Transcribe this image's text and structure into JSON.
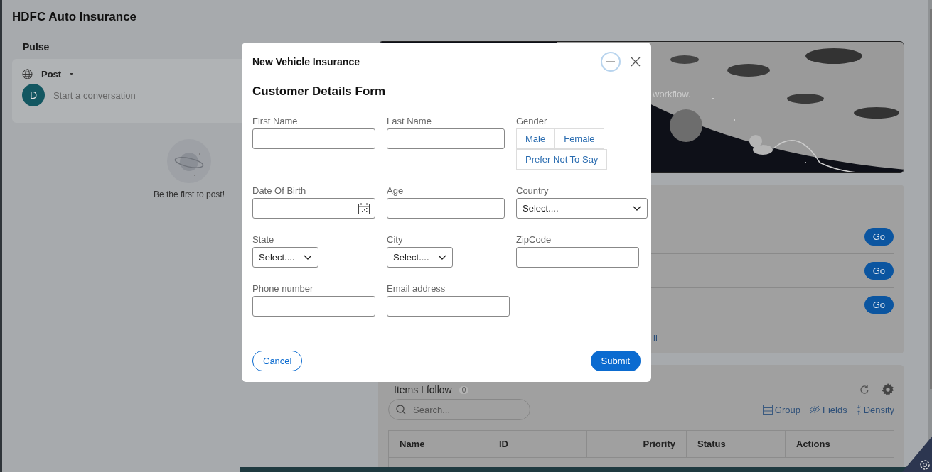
{
  "app_title": "HDFC Auto Insurance",
  "pulse": {
    "title": "Pulse",
    "post_label": "Post",
    "avatar": "D",
    "placeholder": "Start a conversation",
    "empty_text": "Be the first to post!"
  },
  "banner": {
    "text": "workflow."
  },
  "actions_card": {
    "buttons": [
      "Go",
      "Go",
      "Go"
    ],
    "link": "ll"
  },
  "items_card": {
    "title": "Items I follow",
    "count": "0",
    "search_placeholder": "Search...",
    "tools": [
      {
        "kind": "group",
        "label": "Group"
      },
      {
        "kind": "fields",
        "label": "Fields"
      },
      {
        "kind": "density",
        "label": "Density"
      }
    ],
    "columns": [
      "Name",
      "ID",
      "Priority",
      "Status",
      "Actions"
    ]
  },
  "modal": {
    "title": "New Vehicle Insurance",
    "heading": "Customer Details Form",
    "rows": [
      [
        {
          "label": "First Name",
          "kind": "text"
        },
        {
          "label": "Last Name",
          "kind": "text"
        },
        {
          "label": "Gender",
          "kind": "segmented",
          "options": [
            {
              "label": "Male",
              "selected": false
            },
            {
              "label": "Female",
              "selected": false
            },
            {
              "label": "Prefer Not To Say",
              "selected": false
            }
          ]
        }
      ],
      [
        {
          "label": "Date Of Birth",
          "kind": "date"
        },
        {
          "label": "Age",
          "kind": "text"
        },
        {
          "label": "Country",
          "kind": "select",
          "placeholder": "Select...."
        }
      ],
      [
        {
          "label": "State",
          "kind": "select",
          "placeholder": "Select...."
        },
        {
          "label": "City",
          "kind": "select",
          "placeholder": "Select...."
        },
        {
          "label": "ZipCode",
          "kind": "text"
        }
      ],
      [
        {
          "label": "Phone number",
          "kind": "text"
        },
        {
          "label": "Email address",
          "kind": "text"
        }
      ]
    ],
    "cancel": "Cancel",
    "submit": "Submit"
  }
}
